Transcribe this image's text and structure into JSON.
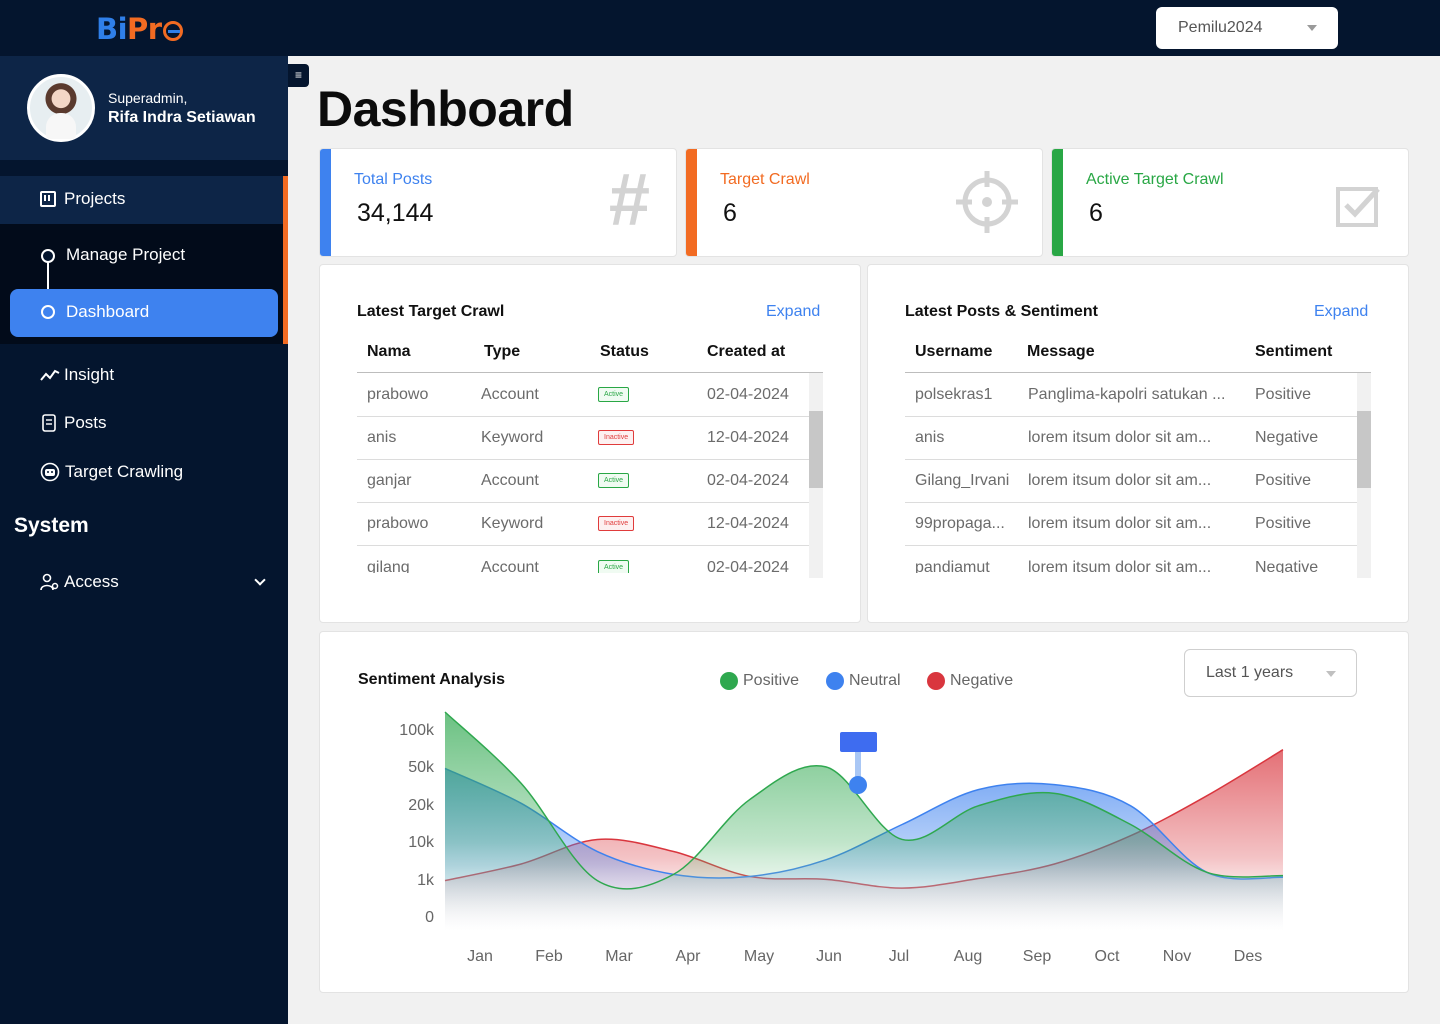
{
  "app": {
    "logo_part1": "Bi",
    "logo_part2": "Pr"
  },
  "topbar": {
    "project_selected": "Pemilu2024"
  },
  "profile": {
    "role": "Superadmin,",
    "name": "Rifa Indra Setiawan"
  },
  "sidebar": {
    "projects_label": "Projects",
    "manage_project_label": "Manage Project",
    "dashboard_label": "Dashboard",
    "insight_label": "Insight",
    "posts_label": "Posts",
    "target_crawling_label": "Target Crawling",
    "system_title": "System",
    "access_label": "Access"
  },
  "page": {
    "title": "Dashboard"
  },
  "stats": [
    {
      "label": "Total Posts",
      "value": "34,144",
      "color": "#3e82ef",
      "icon": "hash-icon"
    },
    {
      "label": "Target Crawl",
      "value": "6",
      "color": "#f26b22",
      "icon": "crosshair-icon"
    },
    {
      "label": "Active Target Crawl",
      "value": "6",
      "color": "#29a745",
      "icon": "checkbox-icon"
    }
  ],
  "latest_target": {
    "title": "Latest Target Crawl",
    "expand": "Expand",
    "headers": [
      "Nama",
      "Type",
      "Status",
      "Created at"
    ],
    "rows": [
      [
        "prabowo",
        "Account",
        "Active",
        "02-04-2024"
      ],
      [
        "anis",
        "Keyword",
        "Inactive",
        "12-04-2024"
      ],
      [
        "ganjar",
        "Account",
        "Active",
        "02-04-2024"
      ],
      [
        "prabowo",
        "Keyword",
        "Inactive",
        "12-04-2024"
      ],
      [
        "gilang",
        "Account",
        "Active",
        "02-04-2024"
      ]
    ]
  },
  "latest_posts": {
    "title": "Latest Posts & Sentiment",
    "expand": "Expand",
    "headers": [
      "Username",
      "Message",
      "Sentiment"
    ],
    "rows": [
      [
        "polsekras1",
        "Panglima-kapolri satukan ...",
        "Positive"
      ],
      [
        "anis",
        "lorem itsum dolor sit am...",
        "Negative"
      ],
      [
        "Gilang_Irvani",
        "lorem itsum dolor sit am...",
        "Positive"
      ],
      [
        "99propaga...",
        "lorem itsum dolor sit am...",
        "Positive"
      ],
      [
        "pandiamut",
        "lorem itsum dolor sit am...",
        "Negative"
      ]
    ]
  },
  "sentiment": {
    "title": "Sentiment Analysis",
    "range_selected": "Last 1 years",
    "legend": [
      {
        "name": "Positive",
        "color": "#2fa84f"
      },
      {
        "name": "Neutral",
        "color": "#3e82ef"
      },
      {
        "name": "Negative",
        "color": "#d9363e"
      }
    ]
  },
  "chart_data": {
    "type": "area",
    "title": "Sentiment Analysis",
    "categories": [
      "Jan",
      "Feb",
      "Mar",
      "Apr",
      "May",
      "Jun",
      "Jul",
      "Aug",
      "Sep",
      "Oct",
      "Nov",
      "Des"
    ],
    "y_ticks": [
      "100k",
      "50k",
      "20k",
      "10k",
      "1k",
      "0"
    ],
    "series": [
      {
        "name": "Positive",
        "color": "#2fa84f",
        "values": [
          135000,
          38000,
          1000,
          2500,
          25000,
          52000,
          11000,
          20000,
          30000,
          15000,
          3000,
          2200
        ]
      },
      {
        "name": "Neutral",
        "color": "#3e82ef",
        "values": [
          50000,
          22000,
          8000,
          2500,
          2000,
          6000,
          15000,
          33000,
          37000,
          20000,
          3000,
          1800
        ]
      },
      {
        "name": "Negative",
        "color": "#d9363e",
        "values": [
          1000,
          5000,
          11000,
          8000,
          2000,
          1300,
          800,
          1500,
          5000,
          12000,
          28000,
          75000
        ]
      }
    ],
    "legend_position": "top-center"
  }
}
